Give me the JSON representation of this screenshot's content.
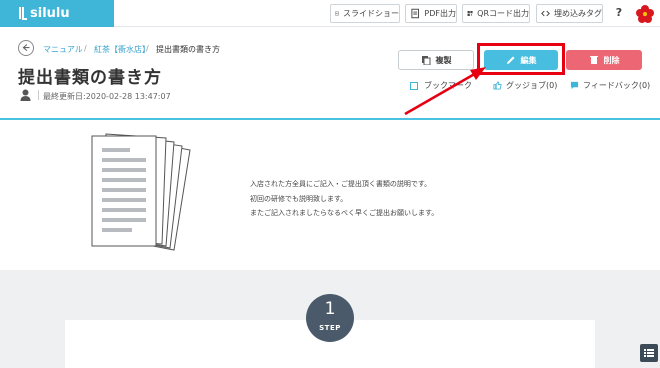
{
  "topbar": {
    "logo_text": "silulu",
    "buttons": [
      {
        "label": "スライドショー",
        "icon": "slideshow-icon"
      },
      {
        "label": "PDF出力",
        "icon": "pdf-icon"
      },
      {
        "label": "QRコード出力",
        "icon": "qr-icon"
      },
      {
        "label": "埋め込みタグ",
        "icon": "code-icon"
      }
    ],
    "help_label": "?"
  },
  "breadcrumb": {
    "items": [
      "マニュアル",
      "紅茶【衝水店】",
      "提出書類の書き方"
    ],
    "separator": "/"
  },
  "page": {
    "title": "提出書類の書き方",
    "updated": "最終更新日:2020-02-28 13:47:07"
  },
  "actions": {
    "copy_label": "複製",
    "edit_label": "編集",
    "delete_label": "削除",
    "bookmark_label": "ブックマーク",
    "goodjob_label": "グッジョブ(0)",
    "feedback_label": "フィードバック(0)"
  },
  "intro": {
    "lines": [
      "入店された方全員にご記入・ご提出頂く書類の説明です。",
      "初回の研修でも説明致します。",
      "またご記入されましたらなるべく早くご提出お願いします。"
    ]
  },
  "step": {
    "number": "1",
    "label": "STEP"
  },
  "colors": {
    "brand": "#3fb6d8",
    "edit": "#47bde0",
    "delete": "#ec6673",
    "highlight": "#e60012",
    "step_badge": "#4a5a6a"
  }
}
